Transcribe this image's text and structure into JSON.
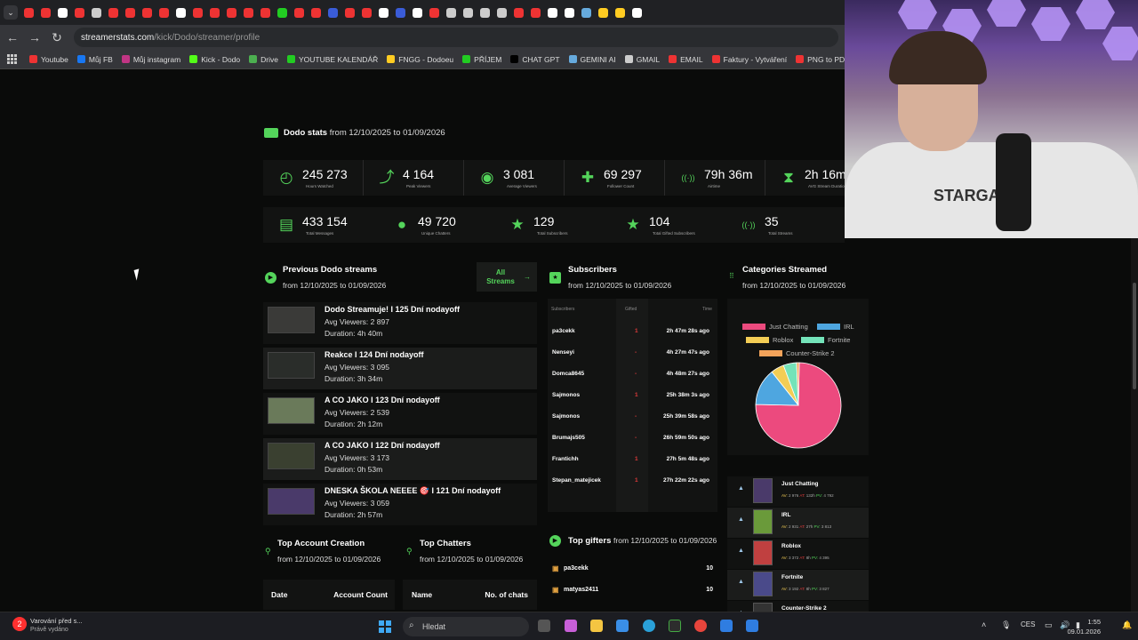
{
  "browser": {
    "url_host": "streamerstats.com",
    "url_path": "/kick/Dodo/streamer/profile",
    "bookmarks": [
      "Youtube",
      "Můj FB",
      "Můj instagram",
      "Kick - Dodo",
      "Drive",
      "YOUTUBE KALENDÁŘ",
      "FNGG - Dodoeu",
      "PŘÍJEM",
      "CHAT GPT",
      "GEMINI AI",
      "GMAIL",
      "EMAIL",
      "Faktury - Vytváření",
      "PNG to PD"
    ]
  },
  "stats": {
    "title": "Dodo stats",
    "range": "from 12/10/2025 to 01/09/2026",
    "row1": [
      {
        "icon": "clock-icon",
        "value": "245 273",
        "label": "Hours Watched"
      },
      {
        "icon": "trend-icon",
        "value": "4 164",
        "label": "Peak Viewers"
      },
      {
        "icon": "eye-icon",
        "value": "3 081",
        "label": "Average Viewers"
      },
      {
        "icon": "follower-icon",
        "value": "69 297",
        "label": "Follower Count"
      },
      {
        "icon": "broadcast-icon",
        "value": "79h 36m",
        "label": "Airtime"
      },
      {
        "icon": "hourglass-icon",
        "value": "2h 16m",
        "label": "AVG Stream Duration"
      }
    ],
    "row2": [
      {
        "icon": "message-icon",
        "value": "433 154",
        "label": "Total Messages"
      },
      {
        "icon": "user-icon",
        "value": "49 720",
        "label": "Unique Chatters"
      },
      {
        "icon": "star-icon",
        "value": "129",
        "label": "Total Subscribers"
      },
      {
        "icon": "star-icon",
        "value": "104",
        "label": "Total Gifted Subscribers"
      },
      {
        "icon": "broadcast-icon",
        "value": "35",
        "label": "Total Streams"
      }
    ]
  },
  "previous": {
    "title": "Previous Dodo streams",
    "range": "from 12/10/2025 to 01/09/2026",
    "all_button": "All Streams",
    "items": [
      {
        "title": "Dodo Streamuje! I 125 Dní nodayoff",
        "avg": "Avg Viewers: 2 897",
        "dur": "Duration: 4h 40m"
      },
      {
        "title": "Reakce I 124 Dní nodayoff",
        "avg": "Avg Viewers: 3 095",
        "dur": "Duration: 3h 34m"
      },
      {
        "title": "A CO JAKO I 123 Dní nodayoff",
        "avg": "Avg Viewers: 2 539",
        "dur": "Duration: 2h 12m"
      },
      {
        "title": "A CO JAKO I 122 Dní nodayoff",
        "avg": "Avg Viewers: 3 173",
        "dur": "Duration: 0h 53m"
      },
      {
        "title": "DNESKA ŠKOLA NEEEE 🎯 I 121 Dní nodayoff",
        "avg": "Avg Viewers: 3 059",
        "dur": "Duration: 2h 57m"
      }
    ]
  },
  "subscribers": {
    "title": "Subscribers",
    "range": "from 12/10/2025 to 01/09/2026",
    "headers": [
      "Subscribers",
      "Gifted",
      "Time"
    ],
    "rows": [
      {
        "name": "pa3cekk",
        "gifted": "1",
        "time": "2h 47m 28s ago"
      },
      {
        "name": "Nenseyi",
        "gifted": "-",
        "time": "4h 27m 47s ago"
      },
      {
        "name": "Domca8645",
        "gifted": "-",
        "time": "4h 48m 27s ago"
      },
      {
        "name": "Sajmonos",
        "gifted": "1",
        "time": "25h 38m 3s ago"
      },
      {
        "name": "Sajmonos",
        "gifted": "-",
        "time": "25h 39m 58s ago"
      },
      {
        "name": "Brumajs505",
        "gifted": "-",
        "time": "26h 59m 50s ago"
      },
      {
        "name": "Frantichh",
        "gifted": "1",
        "time": "27h 5m 48s ago"
      },
      {
        "name": "Stepan_matejicek",
        "gifted": "1",
        "time": "27h 22m 22s ago"
      }
    ]
  },
  "categories": {
    "title": "Categories Streamed",
    "range": "from 12/10/2025 to 01/09/2026",
    "legend": [
      {
        "name": "Just Chatting",
        "color": "#ec4a7e"
      },
      {
        "name": "IRL",
        "color": "#4ea6e0"
      },
      {
        "name": "Roblox",
        "color": "#f3cd55"
      },
      {
        "name": "Fortnite",
        "color": "#74e3b9"
      },
      {
        "name": "Counter-Strike 2",
        "color": "#f3a35a"
      }
    ],
    "rows": [
      {
        "name": "Just Chatting",
        "av": "2 976",
        "at": "132h",
        "pv": "4 792"
      },
      {
        "name": "IRL",
        "av": "2 931",
        "at": "27h",
        "pv": "3 813"
      },
      {
        "name": "Roblox",
        "av": "3 372",
        "at": "8h",
        "pv": "4 395"
      },
      {
        "name": "Fortnite",
        "av": "3 192",
        "at": "8h",
        "pv": "3 827"
      },
      {
        "name": "Counter-Strike 2",
        "av": "",
        "at": "",
        "pv": ""
      }
    ]
  },
  "chart_data": {
    "type": "pie",
    "categories": [
      "Just Chatting",
      "IRL",
      "Roblox",
      "Fortnite",
      "Counter-Strike 2"
    ],
    "values": [
      75,
      14,
      5,
      5,
      1
    ]
  },
  "gifters": {
    "title": "Top gifters",
    "range": "from 12/10/2025 to 01/09/2026",
    "rows": [
      {
        "name": "pa3cekk",
        "value": "10"
      },
      {
        "name": "matyas2411",
        "value": "10"
      }
    ]
  },
  "account": {
    "title": "Top Account Creation",
    "range": "from 12/10/2025 to 01/09/2026",
    "headers": [
      "Date",
      "Account Count"
    ]
  },
  "chatters": {
    "title": "Top Chatters",
    "range": "from 12/10/2025 to 01/09/2026",
    "headers": [
      "Name",
      "No. of chats"
    ]
  },
  "taskbar": {
    "notif_title": "Varování před s...",
    "notif_sub": "Právě vydáno",
    "notif_count": "2",
    "search": "Hledat",
    "lang": "CES",
    "time": "1:55",
    "date": "09.01.2026"
  },
  "webcam": {
    "shirt_text": "STARGAZI"
  }
}
